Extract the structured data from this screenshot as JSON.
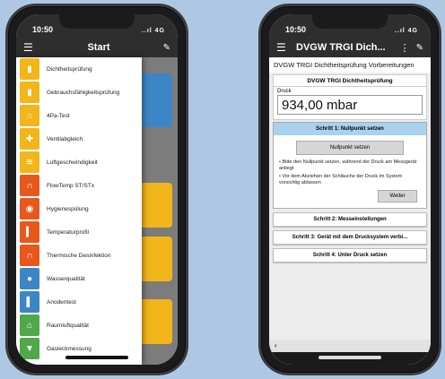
{
  "left_phone": {
    "status": {
      "time": "10:50",
      "signal": "..ıl 4G"
    },
    "appbar": {
      "title": "Start",
      "menu_icon": "hamburger-icon",
      "pin_icon": "pin-icon"
    },
    "menu_items": [
      {
        "label": "Dichtheitsprüfung",
        "color": "#f2b51a",
        "icon": "pressure-gauge-icon",
        "glyph": "▮"
      },
      {
        "label": "Gebrauchsfähigkeitsprüfung",
        "color": "#f2b51a",
        "icon": "gauge-check-icon",
        "glyph": "▮"
      },
      {
        "label": "4Pa-Test",
        "color": "#f2b51a",
        "icon": "house-pressure-icon",
        "glyph": "⌂"
      },
      {
        "label": "Ventilabgleich",
        "color": "#f2b51a",
        "icon": "valve-icon",
        "glyph": "✚"
      },
      {
        "label": "Luftgeschwindigkeit",
        "color": "#f2b51a",
        "icon": "wind-icon",
        "glyph": "≋"
      },
      {
        "label": "FlowTemp ST/STx",
        "color": "#e8581d",
        "icon": "pipe-temperature-icon",
        "glyph": "∩"
      },
      {
        "label": "Hygienespülung",
        "color": "#e8581d",
        "icon": "tap-water-icon",
        "glyph": "◉"
      },
      {
        "label": "Temperaturprofil",
        "color": "#e8581d",
        "icon": "thermometer-icon",
        "glyph": "▍"
      },
      {
        "label": "Thermische Desinfektion",
        "color": "#e8581d",
        "icon": "pipe-heat-icon",
        "glyph": "∩"
      },
      {
        "label": "Wasserqualität",
        "color": "#3d86c6",
        "icon": "water-drop-icon",
        "glyph": "●"
      },
      {
        "label": "Anodentest",
        "color": "#3d86c6",
        "icon": "anode-icon",
        "glyph": "▌"
      },
      {
        "label": "Raumluftqualität",
        "color": "#4fa84a",
        "icon": "house-air-icon",
        "glyph": "⌂"
      },
      {
        "label": "Gasleckmessung",
        "color": "#4fa84a",
        "icon": "gas-leak-icon",
        "glyph": "▼"
      }
    ]
  },
  "right_phone": {
    "status": {
      "time": "10:50",
      "signal": "..ıl 4G"
    },
    "appbar": {
      "title": "DVGW TRGI Dich...",
      "menu_icon": "hamburger-icon",
      "more_icon": "more-vertical-icon",
      "pin_icon": "pin-icon"
    },
    "header": "DVGW TRGI Dichtheitsprüfung Vorbereitungen",
    "panel": {
      "title": "DVGW TRGI Dichtheitsprüfung",
      "label": "Druck",
      "value": "934,00 mbar"
    },
    "step1": {
      "title": "Schritt 1: Nullpunkt setzen",
      "button": "Nullpunkt setzen",
      "note1": "• Bitte den Nullpunkt setzen, während der Druck am Messgerät anliegt",
      "note2": "• Vor dem Abziehen der Schläuche der Druck im System vorsichtig ablassen",
      "next": "Weiter"
    },
    "steps": [
      "Schritt 2: Messeinstellungen",
      "Schritt 3: Gerät mit dem Drucksystem verbi...",
      "Schritt 4: Unter Druck setzen"
    ],
    "back_icon": "‹"
  }
}
